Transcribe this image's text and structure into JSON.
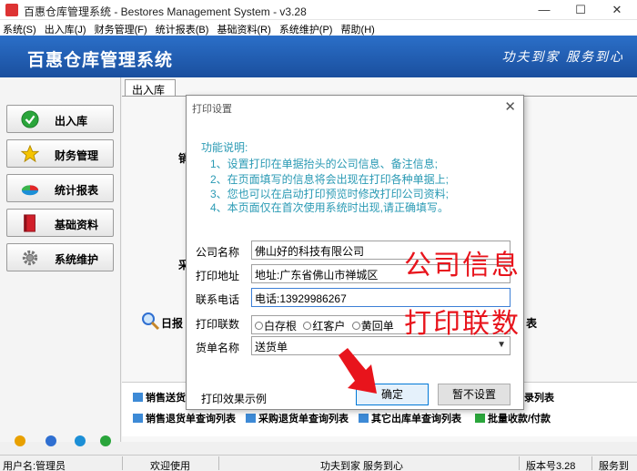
{
  "window": {
    "title": "百惠仓库管理系统 - Bestores Management System - v3.28",
    "minimize": "—",
    "maximize": "☐",
    "close": "✕"
  },
  "menu": [
    "系统(S)",
    "出入库(J)",
    "财务管理(F)",
    "统计报表(B)",
    "基础资料(R)",
    "系统维护(P)",
    "帮助(H)"
  ],
  "banner": {
    "brand": "百惠仓库管理系统",
    "slogan": "功夫到家 服务到心"
  },
  "sidebar": {
    "items": [
      {
        "label": "出入库",
        "icon": "check-icon"
      },
      {
        "label": "财务管理",
        "icon": "star-icon"
      },
      {
        "label": "统计报表",
        "icon": "pie-chart-icon"
      },
      {
        "label": "基础资料",
        "icon": "book-icon"
      },
      {
        "label": "系统维护",
        "icon": "gear-icon"
      }
    ]
  },
  "tab": {
    "label": "出入库"
  },
  "workspace": {
    "partial_1": "销",
    "partial_2": "采",
    "partial_3": "日报",
    "partial_4": "表",
    "links_row1": [
      "销售送货",
      "录列表"
    ],
    "links_row2": [
      "销售退货单查询列表",
      "采购退货单查询列表",
      "其它出库单查询列表",
      "批量收款/付款"
    ]
  },
  "statusbar": {
    "user": "用户名:管理员",
    "welcome": "欢迎使用",
    "slogan": "功夫到家 服务到心",
    "version": "版本号3.28",
    "service": "服务到"
  },
  "dialog": {
    "title": "打印设置",
    "close": "✕",
    "instructions": [
      "功能说明:",
      "1、设置打印在单据抬头的公司信息、备注信息;",
      "2、在页面填写的信息将会出现在打印各种单据上;",
      "3、您也可以在启动打印预览时修改打印公司资料;",
      "4、本页面仅在首次使用系统时出现,请正确填写。"
    ],
    "fields": {
      "company_label": "公司名称",
      "company_value": "佛山好的科技有限公司",
      "address_label": "打印地址",
      "address_value": "地址:广东省佛山市禅城区",
      "phone_label": "联系电话",
      "phone_value": "电话:13929986267",
      "copies_label": "打印联数",
      "copies_options": [
        "白存根",
        "红客户",
        "黄回单"
      ],
      "doc_label": "货单名称",
      "doc_value": "送货单"
    },
    "preview_label": "打印效果示例",
    "confirm": "确定",
    "skip": "暂不设置"
  },
  "annotations": {
    "company_info": "公司信息",
    "print_copies": "打印联数"
  },
  "colors": {
    "banner": "#2b6fc8",
    "instructions": "#2a9ab4",
    "annotation": "#e8141c"
  }
}
